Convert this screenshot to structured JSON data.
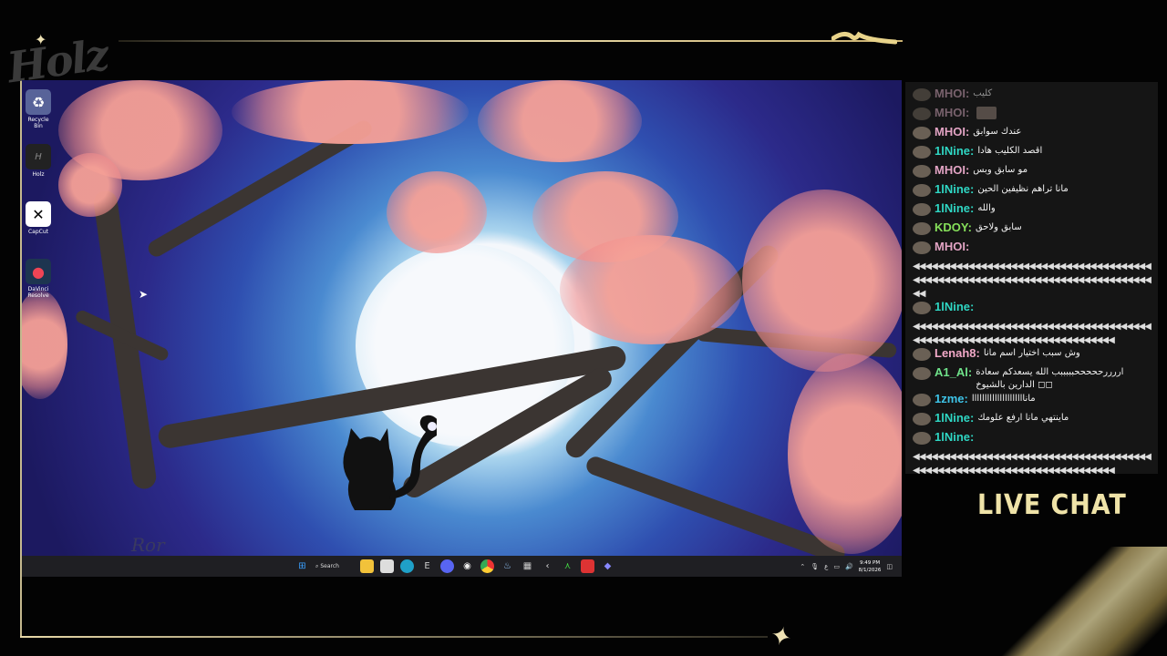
{
  "brand": {
    "logo_text": "Holz"
  },
  "desktop": {
    "icons": [
      {
        "label": "Recycle Bin",
        "icon": "recycle-bin-icon"
      },
      {
        "label": "Holz",
        "icon": "holz-app-icon"
      },
      {
        "label": "CapCut",
        "icon": "capcut-icon"
      },
      {
        "label": "DaVinci Resolve",
        "icon": "davinci-resolve-icon"
      }
    ],
    "wallpaper_signature": "Ror"
  },
  "taskbar": {
    "search_label": "Search",
    "clock_time": "9:49 PM",
    "clock_date": "8/1/2026",
    "tray_lang": "ع"
  },
  "chat": {
    "title": "LIVE CHAT",
    "messages": [
      {
        "user": "MHOI:",
        "color": "#c9a0b3",
        "text": "كليب",
        "faded": true
      },
      {
        "user": "MHOI:",
        "color": "#c9a0b3",
        "text": "",
        "emote": true,
        "faded": true
      },
      {
        "user": "MHOI:",
        "color": "#e3a4c4",
        "text": "عندك سوابق"
      },
      {
        "user": "1lNine:",
        "color": "#2fd6c3",
        "text": "اقصد الكليب هادا"
      },
      {
        "user": "MHOI:",
        "color": "#e3a4c4",
        "text": "مو سابق وبس"
      },
      {
        "user": "1lNine:",
        "color": "#2fd6c3",
        "text": "مانا تراهم نظيفين الحين"
      },
      {
        "user": "1lNine:",
        "color": "#2fd6c3",
        "text": "والله"
      },
      {
        "user": "KDOY:",
        "color": "#86e05a",
        "text": "سابق ولاحق"
      },
      {
        "user": "MHOI:",
        "color": "#e3a4c4",
        "text": ""
      },
      {
        "wrap": "◀◀◀◀◀◀◀◀◀◀◀◀◀◀◀◀◀◀◀◀◀◀◀◀◀◀◀◀◀◀◀◀◀◀◀◀◀◀◀◀◀◀◀◀◀◀◀◀◀◀◀◀◀◀◀◀◀◀◀◀◀◀◀◀◀◀◀◀◀◀◀◀◀◀◀◀◀◀◀◀"
      },
      {
        "user": "1lNine:",
        "color": "#2fd6c3",
        "text": ""
      },
      {
        "wrap": "◀◀◀◀◀◀◀◀◀◀◀◀◀◀◀◀◀◀◀◀◀◀◀◀◀◀◀◀◀◀◀◀◀◀◀◀◀◀◀◀◀◀◀◀◀◀◀◀◀◀◀◀◀◀◀◀◀◀◀◀◀◀◀◀◀◀◀◀◀◀◀◀"
      },
      {
        "user": "Lenah8:",
        "color": "#f2a9c8",
        "text": "وش سبب اختيار اسم مانا"
      },
      {
        "user": "A1_Al:",
        "color": "#6fe28a",
        "text": "اررررحححححبببببب الله يسعدكم سعادة الدارين بالشيوخ ◻◻"
      },
      {
        "user": "1zme:",
        "color": "#3ec4e8",
        "text": "مانااااااااااااااااااااا"
      },
      {
        "user": "1lNine:",
        "color": "#2fd6c3",
        "text": "ماينتهي مانا ارفع علومك"
      },
      {
        "user": "1lNine:",
        "color": "#2fd6c3",
        "text": ""
      },
      {
        "wrap": "◀◀◀◀◀◀◀◀◀◀◀◀◀◀◀◀◀◀◀◀◀◀◀◀◀◀◀◀◀◀◀◀◀◀◀◀◀◀◀◀◀◀◀◀◀◀◀◀◀◀◀◀◀◀◀◀◀◀◀◀◀◀◀◀◀◀◀◀◀◀◀◀"
      }
    ]
  }
}
